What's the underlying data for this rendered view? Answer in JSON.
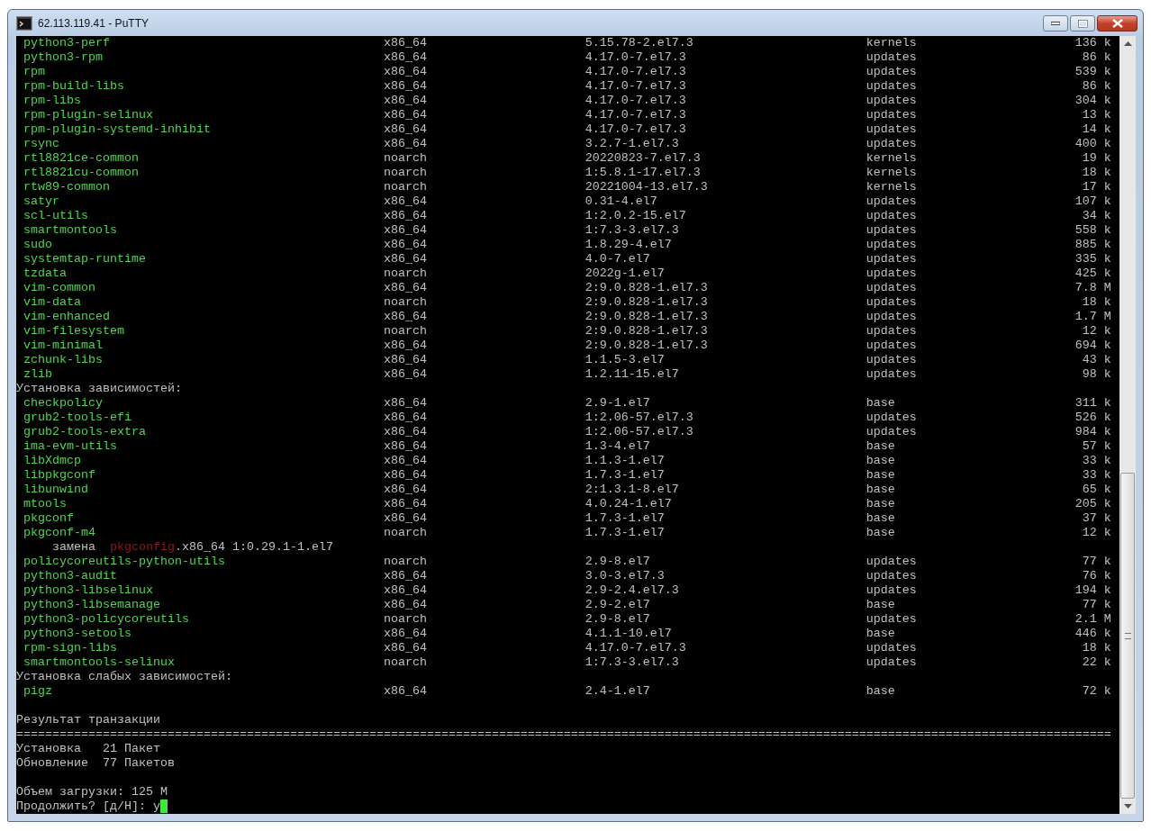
{
  "window": {
    "title": "62.113.119.41 - PuTTY"
  },
  "lines": [
    {
      "kind": "package",
      "name": "python3-perf",
      "arch": "x86_64",
      "version": "5.15.78-2.el7.3",
      "repo": "kernels",
      "size": "136 k"
    },
    {
      "kind": "package",
      "name": "python3-rpm",
      "arch": "x86_64",
      "version": "4.17.0-7.el7.3",
      "repo": "updates",
      "size": "86 k"
    },
    {
      "kind": "package",
      "name": "rpm",
      "arch": "x86_64",
      "version": "4.17.0-7.el7.3",
      "repo": "updates",
      "size": "539 k"
    },
    {
      "kind": "package",
      "name": "rpm-build-libs",
      "arch": "x86_64",
      "version": "4.17.0-7.el7.3",
      "repo": "updates",
      "size": "86 k"
    },
    {
      "kind": "package",
      "name": "rpm-libs",
      "arch": "x86_64",
      "version": "4.17.0-7.el7.3",
      "repo": "updates",
      "size": "304 k"
    },
    {
      "kind": "package",
      "name": "rpm-plugin-selinux",
      "arch": "x86_64",
      "version": "4.17.0-7.el7.3",
      "repo": "updates",
      "size": "13 k"
    },
    {
      "kind": "package",
      "name": "rpm-plugin-systemd-inhibit",
      "arch": "x86_64",
      "version": "4.17.0-7.el7.3",
      "repo": "updates",
      "size": "14 k"
    },
    {
      "kind": "package",
      "name": "rsync",
      "arch": "x86_64",
      "version": "3.2.7-1.el7.3",
      "repo": "updates",
      "size": "400 k"
    },
    {
      "kind": "package",
      "name": "rtl8821ce-common",
      "arch": "noarch",
      "version": "20220823-7.el7.3",
      "repo": "kernels",
      "size": "19 k"
    },
    {
      "kind": "package",
      "name": "rtl8821cu-common",
      "arch": "noarch",
      "version": "1:5.8.1-17.el7.3",
      "repo": "kernels",
      "size": "18 k"
    },
    {
      "kind": "package",
      "name": "rtw89-common",
      "arch": "noarch",
      "version": "20221004-13.el7.3",
      "repo": "kernels",
      "size": "17 k"
    },
    {
      "kind": "package",
      "name": "satyr",
      "arch": "x86_64",
      "version": "0.31-4.el7",
      "repo": "updates",
      "size": "107 k"
    },
    {
      "kind": "package",
      "name": "scl-utils",
      "arch": "x86_64",
      "version": "1:2.0.2-15.el7",
      "repo": "updates",
      "size": "34 k"
    },
    {
      "kind": "package",
      "name": "smartmontools",
      "arch": "x86_64",
      "version": "1:7.3-3.el7.3",
      "repo": "updates",
      "size": "558 k"
    },
    {
      "kind": "package",
      "name": "sudo",
      "arch": "x86_64",
      "version": "1.8.29-4.el7",
      "repo": "updates",
      "size": "885 k"
    },
    {
      "kind": "package",
      "name": "systemtap-runtime",
      "arch": "x86_64",
      "version": "4.0-7.el7",
      "repo": "updates",
      "size": "335 k"
    },
    {
      "kind": "package",
      "name": "tzdata",
      "arch": "noarch",
      "version": "2022g-1.el7",
      "repo": "updates",
      "size": "425 k"
    },
    {
      "kind": "package",
      "name": "vim-common",
      "arch": "x86_64",
      "version": "2:9.0.828-1.el7.3",
      "repo": "updates",
      "size": "7.8 M"
    },
    {
      "kind": "package",
      "name": "vim-data",
      "arch": "noarch",
      "version": "2:9.0.828-1.el7.3",
      "repo": "updates",
      "size": "18 k"
    },
    {
      "kind": "package",
      "name": "vim-enhanced",
      "arch": "x86_64",
      "version": "2:9.0.828-1.el7.3",
      "repo": "updates",
      "size": "1.7 M"
    },
    {
      "kind": "package",
      "name": "vim-filesystem",
      "arch": "noarch",
      "version": "2:9.0.828-1.el7.3",
      "repo": "updates",
      "size": "12 k"
    },
    {
      "kind": "package",
      "name": "vim-minimal",
      "arch": "x86_64",
      "version": "2:9.0.828-1.el7.3",
      "repo": "updates",
      "size": "694 k"
    },
    {
      "kind": "package",
      "name": "zchunk-libs",
      "arch": "x86_64",
      "version": "1.1.5-3.el7",
      "repo": "updates",
      "size": "43 k"
    },
    {
      "kind": "package",
      "name": "zlib",
      "arch": "x86_64",
      "version": "1.2.11-15.el7",
      "repo": "updates",
      "size": "98 k"
    },
    {
      "kind": "text",
      "text": "Установка зависимостей:"
    },
    {
      "kind": "package",
      "name": "checkpolicy",
      "arch": "x86_64",
      "version": "2.9-1.el7",
      "repo": "base",
      "size": "311 k"
    },
    {
      "kind": "package",
      "name": "grub2-tools-efi",
      "arch": "x86_64",
      "version": "1:2.06-57.el7.3",
      "repo": "updates",
      "size": "526 k"
    },
    {
      "kind": "package",
      "name": "grub2-tools-extra",
      "arch": "x86_64",
      "version": "1:2.06-57.el7.3",
      "repo": "updates",
      "size": "984 k"
    },
    {
      "kind": "package",
      "name": "ima-evm-utils",
      "arch": "x86_64",
      "version": "1.3-4.el7",
      "repo": "base",
      "size": "57 k"
    },
    {
      "kind": "package",
      "name": "libXdmcp",
      "arch": "x86_64",
      "version": "1.1.3-1.el7",
      "repo": "base",
      "size": "33 k"
    },
    {
      "kind": "package",
      "name": "libpkgconf",
      "arch": "x86_64",
      "version": "1.7.3-1.el7",
      "repo": "base",
      "size": "33 k"
    },
    {
      "kind": "package",
      "name": "libunwind",
      "arch": "x86_64",
      "version": "2:1.3.1-8.el7",
      "repo": "base",
      "size": "65 k"
    },
    {
      "kind": "package",
      "name": "mtools",
      "arch": "x86_64",
      "version": "4.0.24-1.el7",
      "repo": "base",
      "size": "205 k"
    },
    {
      "kind": "package",
      "name": "pkgconf",
      "arch": "x86_64",
      "version": "1.7.3-1.el7",
      "repo": "base",
      "size": "37 k"
    },
    {
      "kind": "package",
      "name": "pkgconf-m4",
      "arch": "noarch",
      "version": "1.7.3-1.el7",
      "repo": "base",
      "size": "12 k"
    },
    {
      "kind": "replaces",
      "label": "замена",
      "package": "pkgconfig",
      "rest": ".x86_64 1:0.29.1-1.el7"
    },
    {
      "kind": "package",
      "name": "policycoreutils-python-utils",
      "arch": "noarch",
      "version": "2.9-8.el7",
      "repo": "updates",
      "size": "77 k"
    },
    {
      "kind": "package",
      "name": "python3-audit",
      "arch": "x86_64",
      "version": "3.0-3.el7.3",
      "repo": "updates",
      "size": "76 k"
    },
    {
      "kind": "package",
      "name": "python3-libselinux",
      "arch": "x86_64",
      "version": "2.9-2.4.el7.3",
      "repo": "updates",
      "size": "194 k"
    },
    {
      "kind": "package",
      "name": "python3-libsemanage",
      "arch": "x86_64",
      "version": "2.9-2.el7",
      "repo": "base",
      "size": "77 k"
    },
    {
      "kind": "package",
      "name": "python3-policycoreutils",
      "arch": "noarch",
      "version": "2.9-8.el7",
      "repo": "updates",
      "size": "2.1 M"
    },
    {
      "kind": "package",
      "name": "python3-setools",
      "arch": "x86_64",
      "version": "4.1.1-10.el7",
      "repo": "base",
      "size": "446 k"
    },
    {
      "kind": "package",
      "name": "rpm-sign-libs",
      "arch": "x86_64",
      "version": "4.17.0-7.el7.3",
      "repo": "updates",
      "size": "18 k"
    },
    {
      "kind": "package",
      "name": "smartmontools-selinux",
      "arch": "noarch",
      "version": "1:7.3-3.el7.3",
      "repo": "updates",
      "size": "22 k"
    },
    {
      "kind": "text",
      "text": "Установка слабых зависимостей:"
    },
    {
      "kind": "package",
      "name": "pigz",
      "arch": "x86_64",
      "version": "2.4-1.el7",
      "repo": "base",
      "size": "72 k"
    },
    {
      "kind": "blank"
    },
    {
      "kind": "text",
      "text": "Результат транзакции"
    },
    {
      "kind": "text",
      "text": "========================================================================================================================================================"
    },
    {
      "kind": "text",
      "text": "Установка   21 Пакет"
    },
    {
      "kind": "text",
      "text": "Обновление  77 Пакетов"
    },
    {
      "kind": "blank"
    },
    {
      "kind": "text",
      "text": "Объем загрузки: 125 M"
    },
    {
      "kind": "prompt",
      "text": "Продолжить? [д/Н]: y",
      "cursor": true
    }
  ]
}
